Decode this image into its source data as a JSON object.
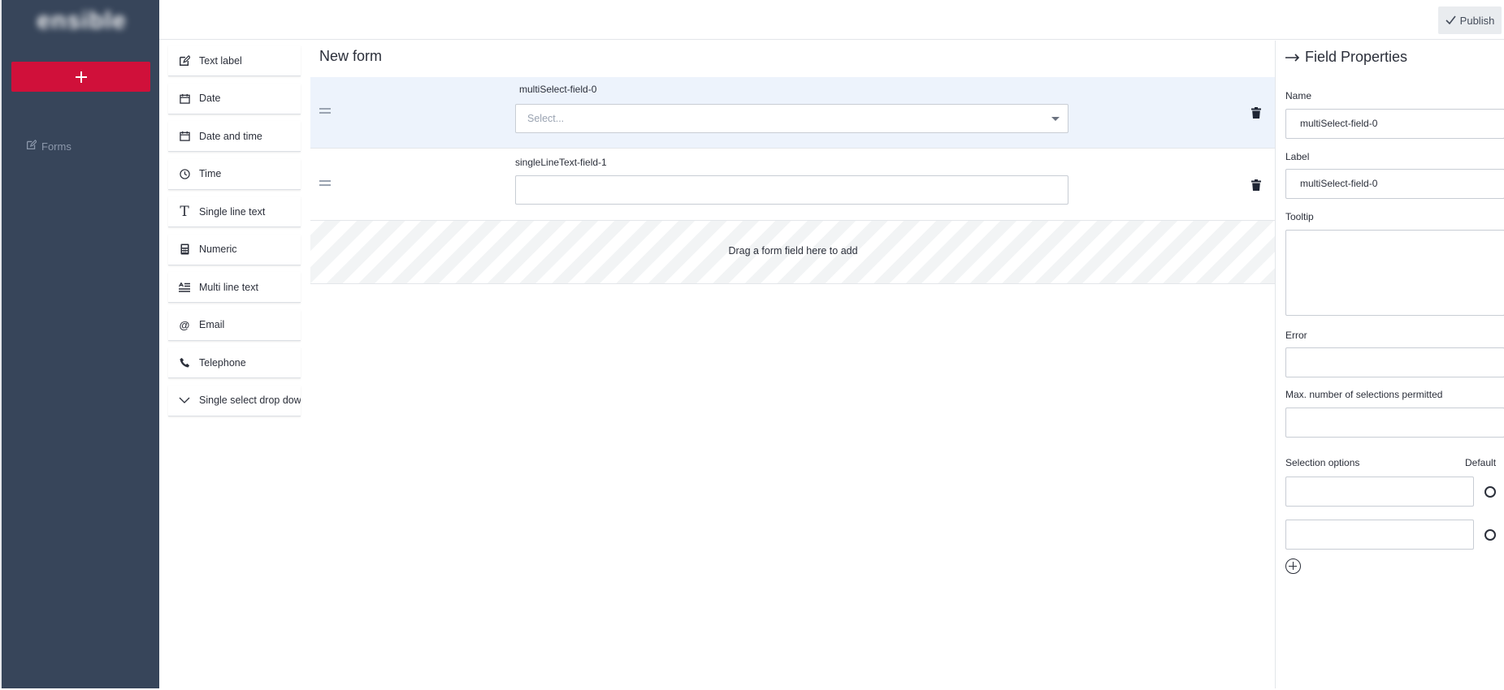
{
  "app": {
    "logo_text": "ensible"
  },
  "sidebar": {
    "forms_label": "Forms"
  },
  "toolbar": {
    "publish_label": "Publish"
  },
  "palette": {
    "items": [
      {
        "label": "Text label",
        "icon": "edit-icon"
      },
      {
        "label": "Date",
        "icon": "calendar-icon"
      },
      {
        "label": "Date and time",
        "icon": "calendar-icon"
      },
      {
        "label": "Time",
        "icon": "clock-icon"
      },
      {
        "label": "Single line text",
        "icon": "text-t-icon"
      },
      {
        "label": "Numeric",
        "icon": "calculator-icon"
      },
      {
        "label": "Multi line text",
        "icon": "multiline-text-icon"
      },
      {
        "label": "Email",
        "icon": "at-sign-icon"
      },
      {
        "label": "Telephone",
        "icon": "phone-icon"
      },
      {
        "label": "Single select drop down",
        "icon": "chevron-down-icon"
      }
    ]
  },
  "form": {
    "title": "New form",
    "fields": [
      {
        "label": "multiSelect-field-0",
        "type": "multi-select",
        "placeholder": "Select...",
        "selected": true
      },
      {
        "label": "singleLineText-field-1",
        "type": "single-line-text",
        "value": ""
      }
    ],
    "dropzone_text": "Drag a form field here to add"
  },
  "properties": {
    "title": "Field Properties",
    "name_label": "Name",
    "name_value": "multiSelect-field-0",
    "label_label": "Label",
    "label_value": "multiSelect-field-0",
    "tooltip_label": "Tooltip",
    "tooltip_value": "",
    "error_label": "Error",
    "error_value": "",
    "max_label": "Max. number of selections permitted",
    "max_value": "",
    "options_label": "Selection options",
    "default_label": "Default",
    "options": [
      {
        "value": ""
      },
      {
        "value": ""
      }
    ]
  },
  "colors": {
    "sidebar_bg": "#37455a",
    "accent": "#d0103a",
    "selected_row": "#edf3fc"
  }
}
